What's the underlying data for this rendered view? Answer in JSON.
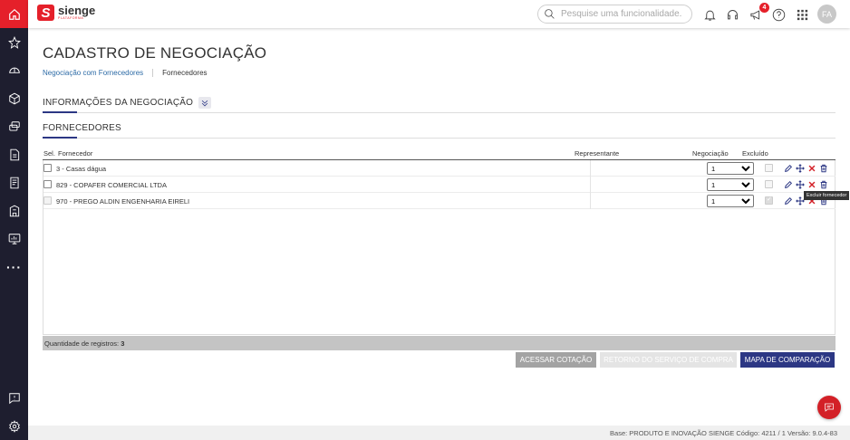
{
  "app": {
    "logo_name": "sienge",
    "logo_sub": "PLATAFORMA"
  },
  "topbar": {
    "search_placeholder": "Pesquise uma funcionalidade.",
    "notifications_badge": "4",
    "avatar_initials": "FA"
  },
  "page": {
    "title": "CADASTRO DE NEGOCIAÇÃO",
    "breadcrumb": {
      "link": "Negociação com Fornecedores",
      "current": "Fornecedores"
    }
  },
  "sections": {
    "info_title": "INFORMAÇÕES DA NEGOCIAÇÃO",
    "suppliers_title": "FORNECEDORES"
  },
  "table": {
    "headers": {
      "sel": "Sel.",
      "supplier": "Fornecedor",
      "representative": "Representante",
      "negotiation": "Negociação",
      "excluded": "Excluído"
    },
    "rows": [
      {
        "supplier": "3 - Casas dágua",
        "negotiation": "1",
        "excluded": false,
        "selectable": true
      },
      {
        "supplier": "829 - COPAFER COMERCIAL LTDA",
        "negotiation": "1",
        "excluded": false,
        "selectable": true
      },
      {
        "supplier": "970 - PREGO ALDIN ENGENHARIA EIRELI",
        "negotiation": "1",
        "excluded": true,
        "selectable": false
      }
    ],
    "tooltip": "Excluir fornecedor",
    "footer_label": "Quantidade de registros:",
    "footer_count": "3"
  },
  "buttons": {
    "access_quote": "ACESSAR COTAÇÃO",
    "return_service": "RETORNO DO SERVIÇO DE COMPRA",
    "compare_map": "MAPA DE COMPARAÇÃO"
  },
  "statusbar": "Base: PRODUTO E INOVAÇÃO SIENGE  Código: 4211 / 1  Versão: 9.0.4-83",
  "colors": {
    "brand_red": "#e5202a",
    "primary_navy": "#2c3784",
    "sidebar": "#1e1e2f"
  }
}
